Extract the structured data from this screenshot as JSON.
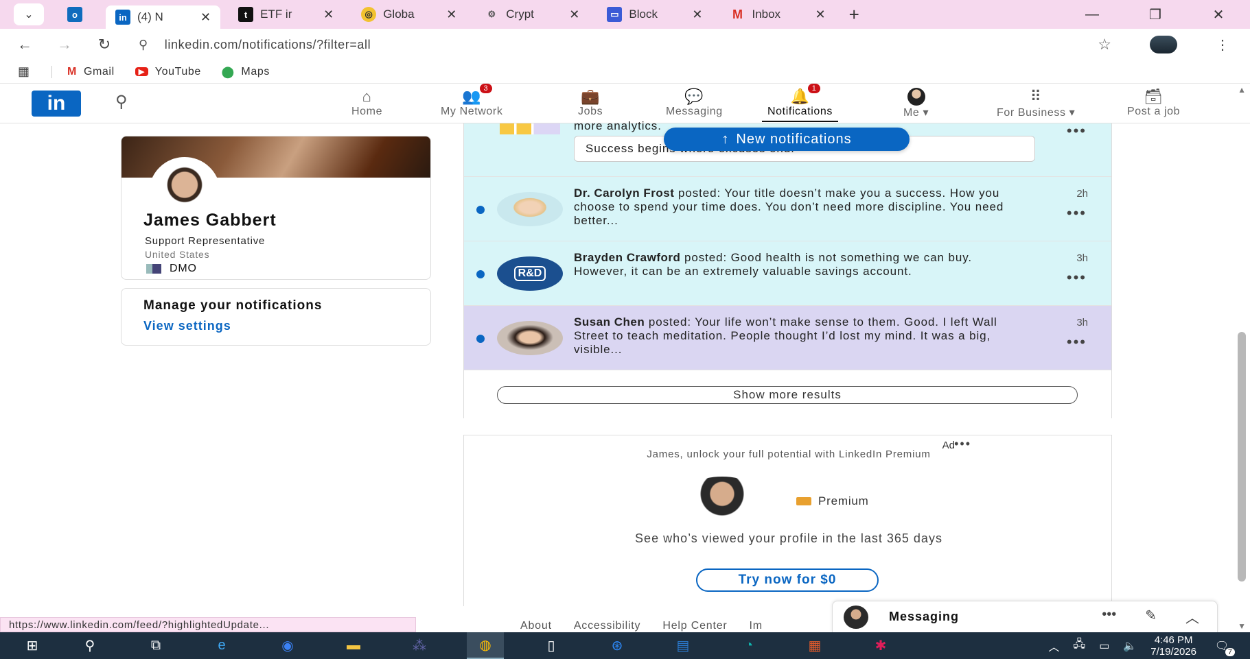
{
  "browser": {
    "tabs": [
      {
        "title": "",
        "icon": "outlook-icon",
        "pinned": true
      },
      {
        "title": "(4) N",
        "icon": "linkedin-icon",
        "active": true
      },
      {
        "title": "ETF ir",
        "icon": "t-icon"
      },
      {
        "title": "Globa",
        "icon": "coin-icon"
      },
      {
        "title": "Crypt",
        "icon": "gear-icon"
      },
      {
        "title": "Block",
        "icon": "card-icon"
      },
      {
        "title": "Inbox",
        "icon": "gmail-icon"
      }
    ],
    "url": "linkedin.com/notifications/?filter=all",
    "bookmarks": [
      {
        "label": "Gmail",
        "icon": "gmail-icon"
      },
      {
        "label": "YouTube",
        "icon": "youtube-icon"
      },
      {
        "label": "Maps",
        "icon": "maps-icon"
      }
    ],
    "status_url": "https://www.linkedin.com/feed/?highlightedUpdate..."
  },
  "nav": {
    "items": [
      {
        "label": "Home",
        "icon": "home-icon"
      },
      {
        "label": "My Network",
        "icon": "network-icon",
        "badge": "3"
      },
      {
        "label": "Jobs",
        "icon": "briefcase-icon"
      },
      {
        "label": "Messaging",
        "icon": "chat-icon"
      },
      {
        "label": "Notifications",
        "icon": "bell-icon",
        "badge": "1",
        "active": true
      },
      {
        "label": "Me",
        "icon": "avatar"
      },
      {
        "label": "For Business",
        "icon": "grid-icon"
      },
      {
        "label": "Post a job",
        "icon": "post-job-icon"
      }
    ]
  },
  "profile": {
    "name": "James Gabbert",
    "title": "Support Representative",
    "location": "United States",
    "org": "DMO"
  },
  "manage": {
    "title": "Manage your notifications",
    "link": "View settings"
  },
  "feed": {
    "partial_text": "more analytics.",
    "partial_box": "Success begins where excuses end.",
    "new_notifications": "New notifications",
    "notifications": [
      {
        "author": "Dr. Carolyn Frost",
        "text": " posted: Your title doesn’t make you a success. How you choose to spend your time does. You don’t need more discipline. You need better...",
        "time": "2h",
        "state": "unread"
      },
      {
        "author": "Brayden Crawford",
        "text": " posted: Good health is not something we can buy. However, it can be an extremely valuable savings account.",
        "time": "3h",
        "state": "unread",
        "avatar_text": "R&D"
      },
      {
        "author": "Susan Chen",
        "text": " posted: Your life won’t make sense to them. Good. I left Wall Street to teach meditation. People thought I’d lost my mind. It was a big, visible...",
        "time": "3h",
        "state": "hover"
      }
    ],
    "show_more": "Show more results"
  },
  "ad": {
    "label": "Ad",
    "headline": "James, unlock your full potential with LinkedIn Premium",
    "premium": "Premium",
    "body": "See who’s viewed your profile in the last 365 days",
    "cta": "Try now for $0"
  },
  "footer": {
    "links": [
      "About",
      "Accessibility",
      "Help Center",
      "Im"
    ]
  },
  "messaging": {
    "title": "Messaging"
  },
  "taskbar": {
    "time": "4:46 PM",
    "date": "7/19/2026",
    "notif_count": "7"
  },
  "colors": {
    "accent": "#0a66c2",
    "unread_bg": "#d8f5f8",
    "hover_bg": "#dad6f2",
    "tabstrip_bg": "#f6d9ee"
  }
}
